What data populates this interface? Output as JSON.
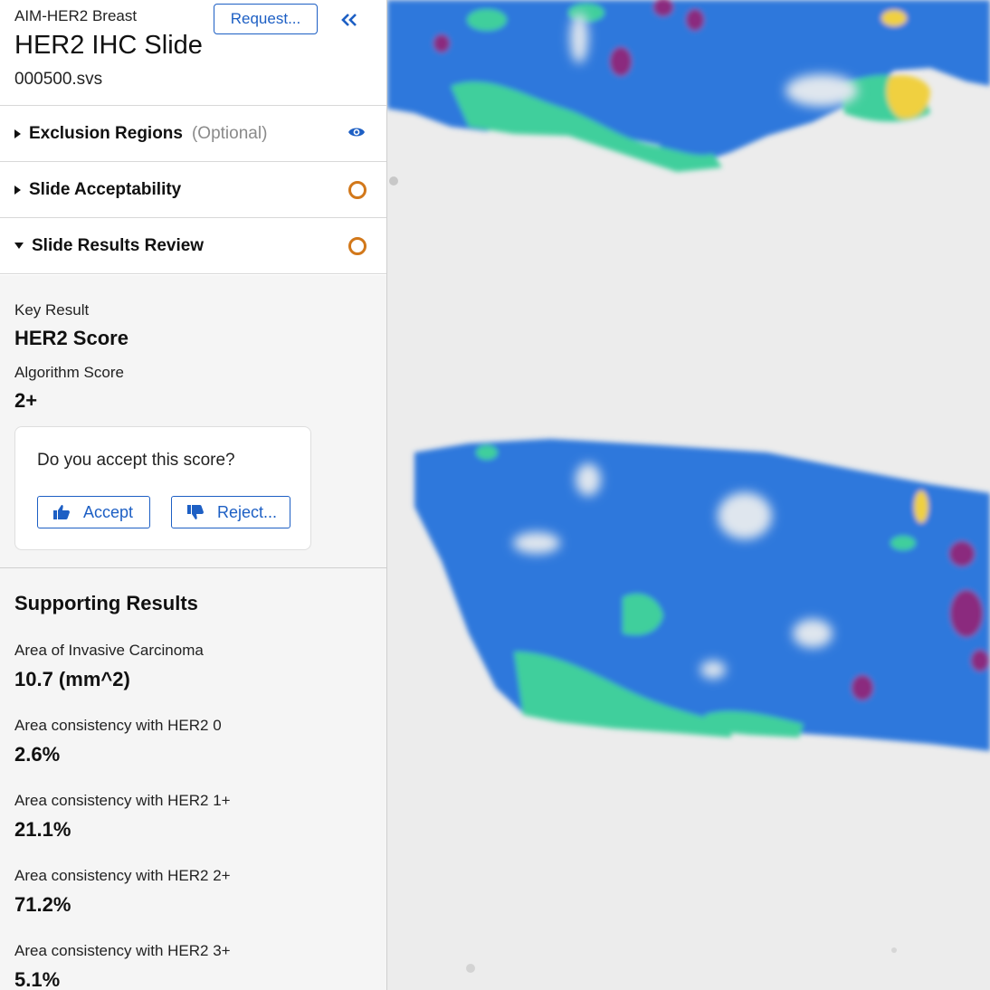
{
  "header": {
    "project": "AIM-HER2 Breast",
    "slide_title": "HER2 IHC Slide",
    "filename": "000500.svs",
    "request_label": "Request..."
  },
  "sections": {
    "exclusion": {
      "label": "Exclusion Regions",
      "optional": "(Optional)"
    },
    "acceptability": {
      "label": "Slide Acceptability"
    },
    "review": {
      "label": "Slide Results Review"
    }
  },
  "review": {
    "key_result_label": "Key Result",
    "key_result_value": "HER2 Score",
    "algorithm_score_label": "Algorithm Score",
    "algorithm_score_value": "2+",
    "accept_question": "Do you accept this score?",
    "accept_label": "Accept",
    "reject_label": "Reject..."
  },
  "supporting": {
    "title": "Supporting Results",
    "items": [
      {
        "label": "Area of Invasive Carcinoma",
        "value": "10.7 (mm^2)"
      },
      {
        "label": "Area consistency with HER2 0",
        "value": "2.6%"
      },
      {
        "label": "Area consistency with HER2 1+",
        "value": "21.1%"
      },
      {
        "label": "Area consistency with HER2 2+",
        "value": "71.2%"
      },
      {
        "label": "Area consistency with HER2 3+",
        "value": "5.1%"
      }
    ]
  },
  "colors": {
    "accent": "#1d5fc4",
    "status_pending": "#d2781a",
    "overlay_her2_0": "#f0d040",
    "overlay_her2_1": "#3fcf9c",
    "overlay_her2_2": "#2a74e0",
    "overlay_her2_3": "#8b2a7e"
  },
  "icons": {
    "collapse": "double-chevron-left-icon",
    "visibility": "eye-icon",
    "accept": "thumbs-up-icon",
    "reject": "thumbs-down-icon"
  }
}
